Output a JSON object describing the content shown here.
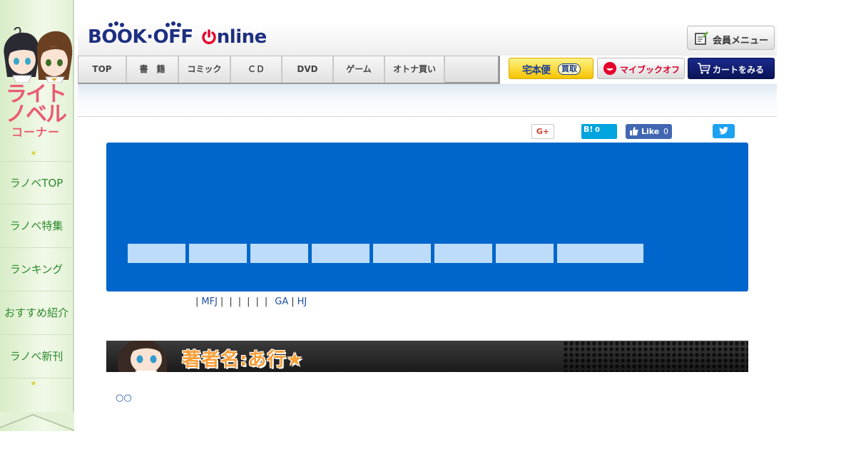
{
  "sidebar": {
    "title_line1": "ライト",
    "title_line2": "ノベル",
    "title_line3": "コーナー",
    "items": [
      {
        "label": "ラノベTOP"
      },
      {
        "label": "ラノベ特集"
      },
      {
        "label": "ランキング"
      },
      {
        "label": "おすすめ紹介"
      },
      {
        "label": "ラノベ新刊"
      }
    ]
  },
  "header": {
    "logo_text_left": "BOOK·OFF",
    "logo_text_right": "nline",
    "member_menu_label": "会員メニュー",
    "nav_tabs": [
      {
        "label": "TOP"
      },
      {
        "label": "書　籍"
      },
      {
        "label": "コミック"
      },
      {
        "label": "ＣＤ"
      },
      {
        "label": "DVD"
      },
      {
        "label": "ゲーム"
      },
      {
        "label": "オトナ買い"
      }
    ],
    "takuhai_label": "宅本便",
    "takuhai_sub": "買取",
    "mybookoff_label": "マイブックオフ",
    "cart_label": "カートをみる"
  },
  "social": {
    "gplus_label": "G+",
    "hatena_label": "B!",
    "hatena_count": "0",
    "fb_label": "Like",
    "fb_count": "0"
  },
  "publisher_links": {
    "sep": "|",
    "mfj": "MFJ",
    "ga": "GA",
    "hj": "HJ"
  },
  "author_banner": {
    "title": "著者名:あ行★"
  },
  "content": {
    "circle_link": "○○"
  },
  "colors": {
    "panel_blue": "#0066cc",
    "tab_light_blue": "#bcdcf9",
    "sidebar_green_text": "#2b8a2b",
    "sidebar_title_pink": "#ea5c73",
    "cart_navy": "#0a1458",
    "banner_orange": "#f6a03a"
  }
}
